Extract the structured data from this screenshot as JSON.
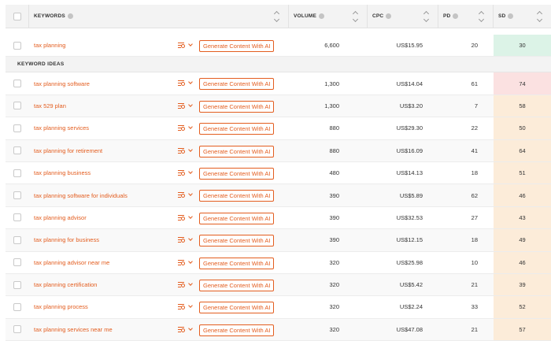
{
  "header": {
    "keywords": "KEYWORDS",
    "volume": "VOLUME",
    "cpc": "CPC",
    "pd": "PD",
    "sd": "SD"
  },
  "button_label": "Generate Content With AI",
  "section_label": "KEYWORD IDEAS",
  "main_row": {
    "keyword": "tax planning",
    "volume": "6,600",
    "cpc": "US$15.95",
    "pd": "20",
    "sd": "30",
    "sd_level": "green"
  },
  "rows": [
    {
      "keyword": "tax planning software",
      "volume": "1,300",
      "cpc": "US$14.04",
      "pd": "61",
      "sd": "74",
      "sd_level": "red"
    },
    {
      "keyword": "tax 529 plan",
      "volume": "1,300",
      "cpc": "US$3.20",
      "pd": "7",
      "sd": "58",
      "sd_level": "orange"
    },
    {
      "keyword": "tax planning services",
      "volume": "880",
      "cpc": "US$29.30",
      "pd": "22",
      "sd": "50",
      "sd_level": "orange"
    },
    {
      "keyword": "tax planning for retirement",
      "volume": "880",
      "cpc": "US$16.09",
      "pd": "41",
      "sd": "64",
      "sd_level": "orange"
    },
    {
      "keyword": "tax planning business",
      "volume": "480",
      "cpc": "US$14.13",
      "pd": "18",
      "sd": "51",
      "sd_level": "orange"
    },
    {
      "keyword": "tax planning software for individuals",
      "volume": "390",
      "cpc": "US$5.89",
      "pd": "62",
      "sd": "46",
      "sd_level": "orange"
    },
    {
      "keyword": "tax planning advisor",
      "volume": "390",
      "cpc": "US$32.53",
      "pd": "27",
      "sd": "43",
      "sd_level": "orange"
    },
    {
      "keyword": "tax planning for business",
      "volume": "390",
      "cpc": "US$12.15",
      "pd": "18",
      "sd": "49",
      "sd_level": "orange"
    },
    {
      "keyword": "tax planning advisor near me",
      "volume": "320",
      "cpc": "US$25.98",
      "pd": "10",
      "sd": "46",
      "sd_level": "orange"
    },
    {
      "keyword": "tax planning certification",
      "volume": "320",
      "cpc": "US$5.42",
      "pd": "21",
      "sd": "39",
      "sd_level": "orange"
    },
    {
      "keyword": "tax planning process",
      "volume": "320",
      "cpc": "US$2.24",
      "pd": "33",
      "sd": "52",
      "sd_level": "orange"
    },
    {
      "keyword": "tax planning services near me",
      "volume": "320",
      "cpc": "US$47.08",
      "pd": "21",
      "sd": "57",
      "sd_level": "orange"
    }
  ],
  "colors": {
    "accent": "#e35d1f",
    "sd_green": "#dcf3e7",
    "sd_red": "#fbe1e1",
    "sd_orange": "#fcecd9"
  }
}
